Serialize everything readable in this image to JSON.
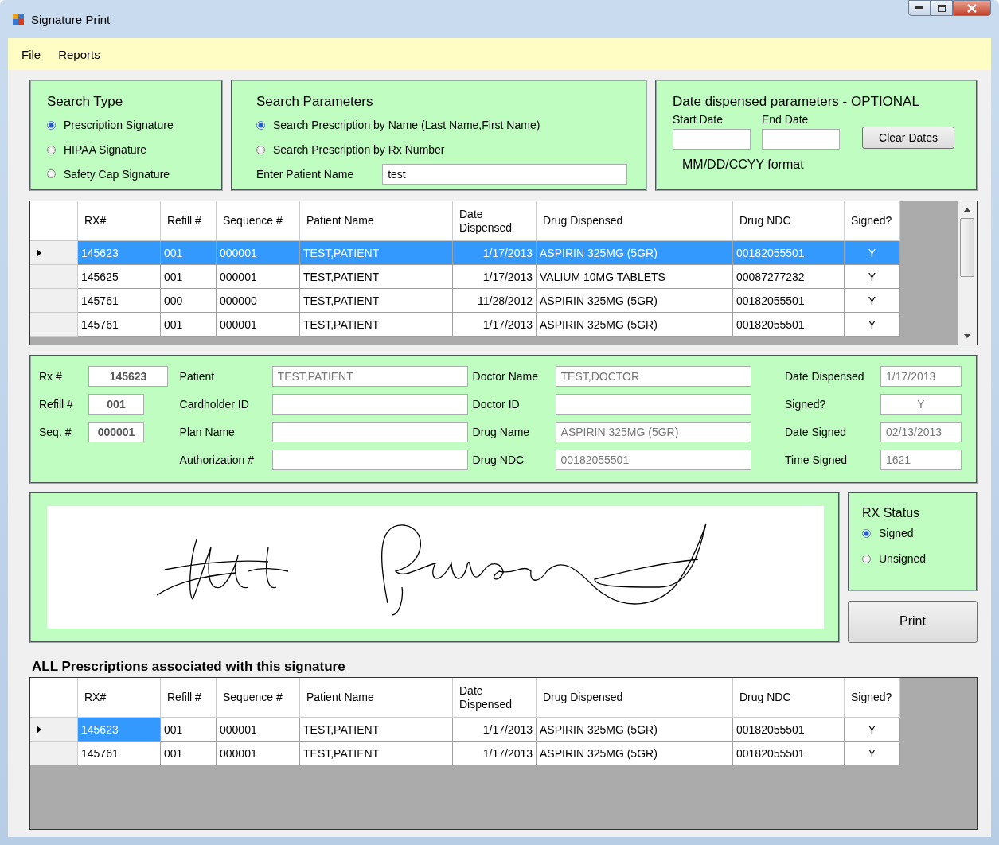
{
  "window": {
    "title": "Signature Print"
  },
  "menu": [
    "File",
    "Reports"
  ],
  "search_type": {
    "title": "Search Type",
    "options": [
      {
        "label": "Prescription Signature",
        "selected": true
      },
      {
        "label": "HIPAA Signature",
        "selected": false
      },
      {
        "label": "Safety Cap Signature",
        "selected": false
      }
    ]
  },
  "search_parameters": {
    "title": "Search Parameters",
    "options": [
      {
        "label": "Search Prescription by Name (Last Name,First Name)",
        "selected": true
      },
      {
        "label": "Search Prescription by Rx Number",
        "selected": false
      }
    ],
    "patient_name_label": "Enter Patient Name",
    "patient_name_value": "test"
  },
  "date_parameters": {
    "title": "Date dispensed parameters - OPTIONAL",
    "start_label": "Start Date",
    "end_label": "End Date",
    "clear_button": "Clear Dates",
    "format_note": "MM/DD/CCYY format"
  },
  "prescriptions_grid": {
    "columns": [
      "RX#",
      "Refill #",
      "Sequence #",
      "Patient Name",
      "Date Dispensed",
      "Drug Dispensed",
      "Drug NDC",
      "Signed?"
    ],
    "rows": [
      {
        "selected": true,
        "cells": [
          "145623",
          "001",
          "000001",
          "TEST,PATIENT",
          "1/17/2013",
          "ASPIRIN 325MG (5GR)",
          "00182055501",
          "Y"
        ]
      },
      {
        "selected": false,
        "cells": [
          "145625",
          "001",
          "000001",
          "TEST,PATIENT",
          "1/17/2013",
          "VALIUM 10MG TABLETS",
          "00087277232",
          "Y"
        ]
      },
      {
        "selected": false,
        "cells": [
          "145761",
          "000",
          "000000",
          "TEST,PATIENT",
          "11/28/2012",
          "ASPIRIN 325MG (5GR)",
          "00182055501",
          "Y"
        ]
      },
      {
        "selected": false,
        "cells": [
          "145761",
          "001",
          "000001",
          "TEST,PATIENT",
          "1/17/2013",
          "ASPIRIN 325MG (5GR)",
          "00182055501",
          "Y"
        ]
      }
    ]
  },
  "details": {
    "columns": [
      [
        {
          "label": "Rx #",
          "value": "145623"
        },
        {
          "label": "Refill #",
          "value": "001"
        },
        {
          "label": "Seq. #",
          "value": "000001"
        }
      ],
      [
        {
          "label": "Patient",
          "value": "TEST,PATIENT"
        },
        {
          "label": "Cardholder ID"
        },
        {
          "label": "Plan Name"
        },
        {
          "label": "Authorization #"
        }
      ],
      [
        {
          "label": "Doctor Name",
          "value": "TEST,DOCTOR"
        },
        {
          "label": "Doctor ID"
        },
        {
          "label": "Drug Name",
          "value": "ASPIRIN 325MG (5GR)"
        },
        {
          "label": "Drug NDC",
          "value": "00182055501"
        }
      ],
      [
        {
          "label": "Date Dispensed",
          "value": "1/17/2013"
        },
        {
          "label": "Signed?",
          "value": "Y"
        },
        {
          "label": "Date Signed",
          "value": "02/13/2013"
        },
        {
          "label": "Time Signed",
          "value": "1621"
        }
      ]
    ]
  },
  "rx_status": {
    "title": "RX Status",
    "options": [
      {
        "label": "Signed",
        "selected": true
      },
      {
        "label": "Unsigned",
        "selected": false
      }
    ]
  },
  "print_button": "Print",
  "associated": {
    "title": "ALL Prescriptions associated with this signature",
    "grid": {
      "columns": [
        "RX#",
        "Refill #",
        "Sequence #",
        "Patient Name",
        "Date Dispensed",
        "Drug Dispensed",
        "Drug NDC",
        "Signed?"
      ],
      "rows": [
        {
          "selected": true,
          "cells": [
            "145623",
            "001",
            "000001",
            "TEST,PATIENT",
            "1/17/2013",
            "ASPIRIN 325MG (5GR)",
            "00182055501",
            "Y"
          ]
        },
        {
          "selected": false,
          "cells": [
            "145761",
            "001",
            "000001",
            "TEST,PATIENT",
            "1/17/2013",
            "ASPIRIN 325MG (5GR)",
            "00182055501",
            "Y"
          ]
        }
      ]
    }
  }
}
